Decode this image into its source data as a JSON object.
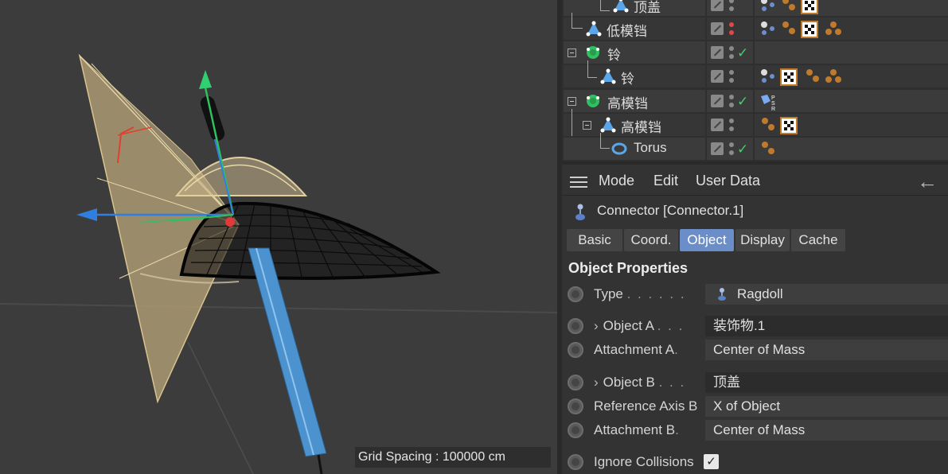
{
  "viewport": {
    "grid_spacing": "Grid Spacing : 100000 cm"
  },
  "object_manager": {
    "rows": [
      {
        "label": "顶盖",
        "icon": "polygon-object-icon",
        "tags": [
          "material-sphere-icon",
          "material-balls-icon",
          "checker-texture-icon"
        ]
      },
      {
        "label": "低模铛",
        "icon": "polygon-object-icon",
        "tags": [
          "material-sphere-icon",
          "material-balls-icon",
          "checker-texture-icon",
          "material-balls-icon"
        ]
      },
      {
        "label": "铃",
        "icon": "null-object-icon",
        "tags": []
      },
      {
        "label": "铃",
        "icon": "polygon-object-icon",
        "tags": [
          "material-sphere-icon",
          "checker-texture-icon",
          "material-balls-icon",
          "material-balls-icon"
        ]
      },
      {
        "label": "高模铛",
        "icon": "null-object-icon",
        "tags": [
          "protection-tag-icon"
        ]
      },
      {
        "label": "高模铛",
        "icon": "polygon-object-icon",
        "tags": [
          "material-balls-icon",
          "checker-texture-icon"
        ]
      },
      {
        "label": "Torus",
        "icon": "torus-icon",
        "tags": [
          "material-balls-icon"
        ]
      }
    ]
  },
  "attributes": {
    "menu": [
      "Mode",
      "Edit",
      "User Data"
    ],
    "object_title": "Connector [Connector.1]",
    "tabs": [
      "Basic",
      "Coord.",
      "Object",
      "Display",
      "Cache"
    ],
    "active_tab": "Object",
    "section_title": "Object Properties",
    "properties": {
      "type_label": "Type",
      "type_value": "Ragdoll",
      "object_a_label": "Object A",
      "object_a_value": "装饰物.1",
      "attachment_a_label": "Attachment A",
      "attachment_a_value": "Center of Mass",
      "object_b_label": "Object B",
      "object_b_value": "顶盖",
      "reference_axis_b_label": "Reference Axis B",
      "reference_axis_b_value": "X of Object",
      "attachment_b_label": "Attachment B",
      "attachment_b_value": "Center of Mass",
      "ignore_collisions_label": "Ignore Collisions",
      "ignore_collisions_checked": true
    }
  }
}
